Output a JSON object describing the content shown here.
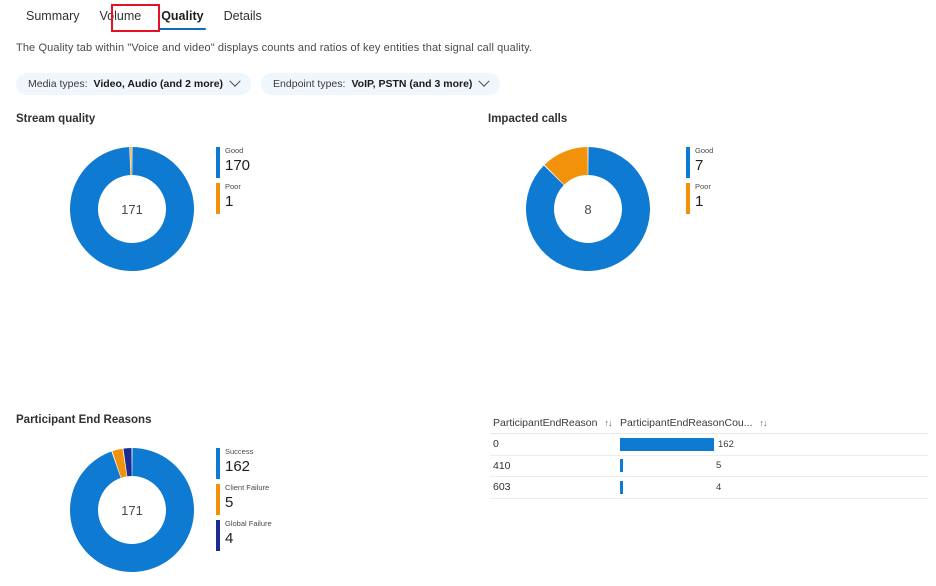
{
  "tabs": [
    {
      "label": "Summary",
      "active": false
    },
    {
      "label": "Volume",
      "active": false
    },
    {
      "label": "Quality",
      "active": true
    },
    {
      "label": "Details",
      "active": false
    }
  ],
  "description": "The Quality tab within \"Voice and video\" displays counts and ratios of key entities that signal call quality.",
  "filters": [
    {
      "name": "Media types:",
      "value": "Video, Audio (and 2 more)",
      "icon": "chevron-down-icon"
    },
    {
      "name": "Endpoint types:",
      "value": "VoIP, PSTN (and 3 more)",
      "icon": "chevron-down-icon"
    }
  ],
  "colors": {
    "primary_blue": "#0f7ad1",
    "orange": "#f2910a",
    "navy": "#1b2b8f",
    "highlight_red": "#e81123",
    "tab_accent": "#0f6cbd",
    "pill_bg": "#eff6fc"
  },
  "panels": {
    "stream_quality": {
      "title": "Stream quality",
      "center_total": "171"
    },
    "impacted_calls": {
      "title": "Impacted calls",
      "center_total": "8"
    },
    "participant_end_reasons": {
      "title": "Participant End Reasons",
      "center_total": "171"
    }
  },
  "table": {
    "columns": [
      {
        "label": "ParticipantEndReason",
        "sort_icon": "sort-updown-icon",
        "sort_glyph": "↑↓"
      },
      {
        "label": "ParticipantEndReasonCou...",
        "sort_icon": "sort-updown-icon",
        "sort_glyph": "↑↓"
      }
    ],
    "rows": [
      {
        "reason": "0",
        "count": "162"
      },
      {
        "reason": "410",
        "count": "5"
      },
      {
        "reason": "603",
        "count": "4"
      }
    ],
    "max_count": 162
  },
  "chart_data": [
    {
      "type": "pie",
      "title": "Stream quality",
      "variant": "donut",
      "total": 171,
      "center_label": "171",
      "labels": [
        "Good",
        "Poor"
      ],
      "values": [
        170,
        1
      ],
      "colors": [
        "#0f7ad1",
        "#f2910a"
      ],
      "legend": "right"
    },
    {
      "type": "pie",
      "title": "Impacted calls",
      "variant": "donut",
      "total": 8,
      "center_label": "8",
      "labels": [
        "Good",
        "Poor"
      ],
      "values": [
        7,
        1
      ],
      "colors": [
        "#0f7ad1",
        "#f2910a"
      ],
      "legend": "right"
    },
    {
      "type": "pie",
      "title": "Participant End Reasons",
      "variant": "donut",
      "total": 171,
      "center_label": "171",
      "labels": [
        "Success",
        "Client Failure",
        "Global Failure"
      ],
      "values": [
        162,
        5,
        4
      ],
      "colors": [
        "#0f7ad1",
        "#f2910a",
        "#1b2b8f"
      ],
      "legend": "right"
    },
    {
      "type": "bar",
      "title": "ParticipantEndReason",
      "orientation": "horizontal",
      "categories": [
        "0",
        "410",
        "603"
      ],
      "values": [
        162,
        5,
        4
      ],
      "xlabel": "ParticipantEndReasonCount",
      "ylabel": "ParticipantEndReason",
      "xlim": [
        0,
        162
      ],
      "grid": false,
      "color": "#0f7ad1"
    }
  ]
}
